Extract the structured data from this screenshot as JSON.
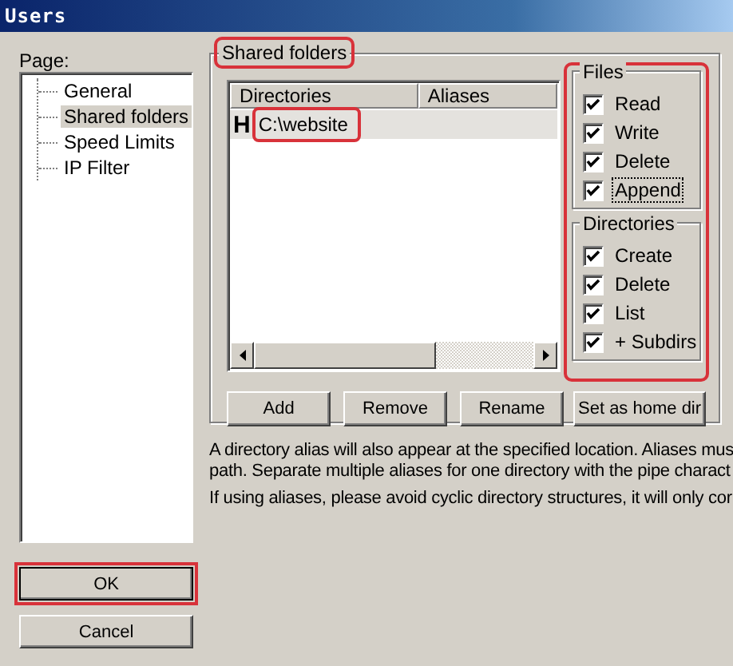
{
  "window": {
    "title": "Users"
  },
  "page_label": "Page:",
  "pages": [
    {
      "label": "General",
      "selected": false
    },
    {
      "label": "Shared folders",
      "selected": true
    },
    {
      "label": "Speed Limits",
      "selected": false
    },
    {
      "label": "IP Filter",
      "selected": false
    }
  ],
  "shared_folders": {
    "title": "Shared folders",
    "highlighted": true,
    "columns": [
      "Directories",
      "Aliases"
    ],
    "rows": [
      {
        "home_marker": "H",
        "directory": "C:\\website",
        "selected": true,
        "highlighted": true
      }
    ],
    "buttons": [
      "Add",
      "Remove",
      "Rename",
      "Set as home dir"
    ]
  },
  "permissions": {
    "highlighted": true,
    "groups": [
      {
        "title": "Files",
        "items": [
          {
            "label": "Read",
            "checked": true,
            "focused": false
          },
          {
            "label": "Write",
            "checked": true,
            "focused": false
          },
          {
            "label": "Delete",
            "checked": true,
            "focused": false
          },
          {
            "label": "Append",
            "checked": true,
            "focused": true
          }
        ]
      },
      {
        "title": "Directories",
        "items": [
          {
            "label": "Create",
            "checked": true,
            "focused": false
          },
          {
            "label": "Delete",
            "checked": true,
            "focused": false
          },
          {
            "label": "List",
            "checked": true,
            "focused": false
          },
          {
            "label": "+ Subdirs",
            "checked": true,
            "focused": false
          }
        ]
      }
    ]
  },
  "notes": [
    "A directory alias will also appear at the specified location. Aliases mus\npath. Separate multiple aliases for one directory with the pipe charact",
    "If using aliases, please avoid cyclic directory structures, it will only cor"
  ],
  "buttons": [
    {
      "label": "OK",
      "highlighted": true
    },
    {
      "label": "Cancel",
      "highlighted": false
    }
  ]
}
